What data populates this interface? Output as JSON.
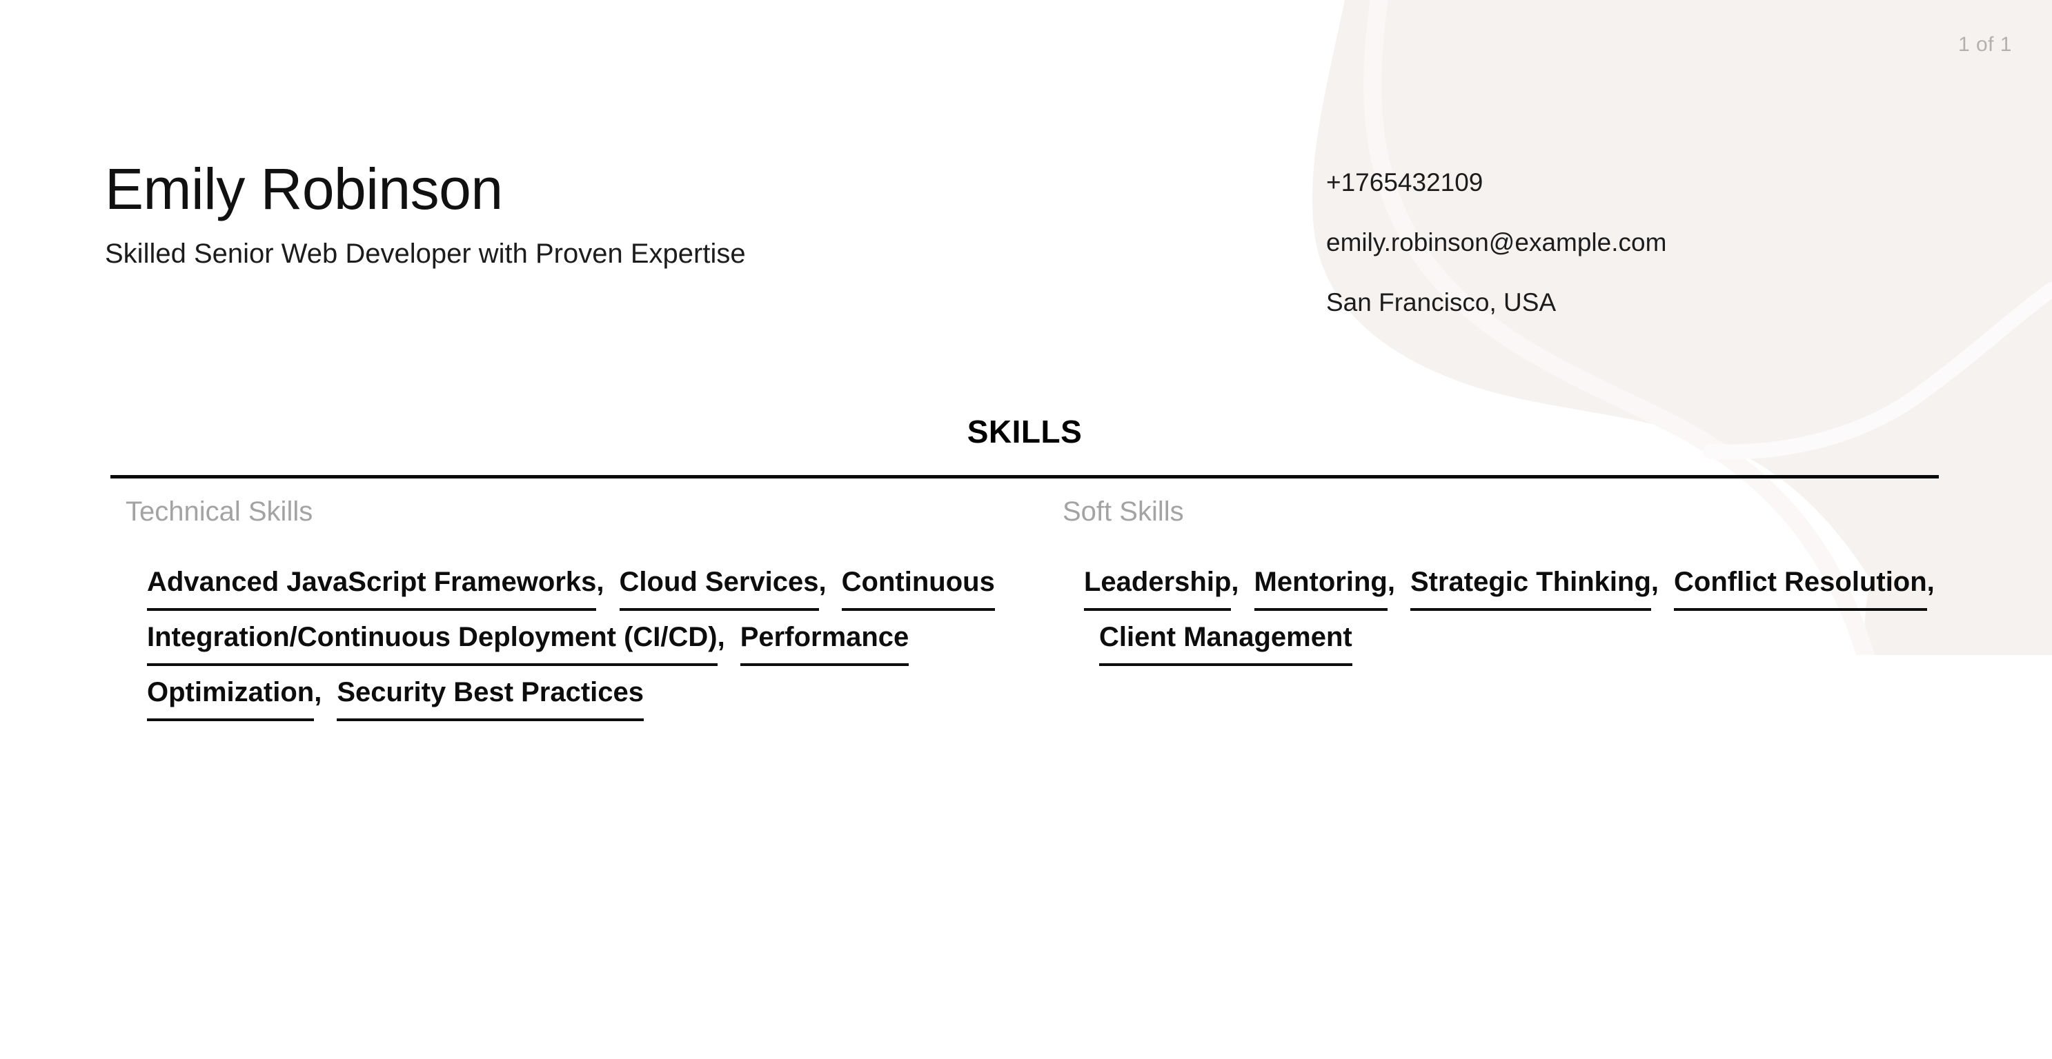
{
  "document": {
    "type": "resume",
    "page_indicator": "1 of 1"
  },
  "header": {
    "full_name": "Emily Robinson",
    "headline": "Skilled Senior Web Developer with Proven Expertise",
    "contact": {
      "phone": "+1765432109",
      "email": "emily.robinson@example.com",
      "location": "San Francisco, USA"
    }
  },
  "skills_section": {
    "title": "SKILLS",
    "columns": [
      {
        "label": "Technical Skills",
        "items": [
          "Advanced JavaScript Frameworks",
          "Cloud Services",
          "Continuous Integration/Continuous Deployment (CI/CD)",
          "Performance Optimization",
          "Security Best Practices"
        ],
        "separator": ","
      },
      {
        "label": "Soft Skills",
        "items": [
          "Leadership",
          "Mentoring",
          "Strategic Thinking",
          "Conflict Resolution",
          "Client Management"
        ],
        "separator": ","
      }
    ]
  },
  "colors": {
    "background": "#ffffff",
    "text": "#1a1a1a",
    "muted_label": "#a3a3a3",
    "page_indicator": "#b4b0ae",
    "rule": "#0a0a0a",
    "decor_blob": "#f6f2f0",
    "decor_swoosh": "#fbf8f7"
  }
}
